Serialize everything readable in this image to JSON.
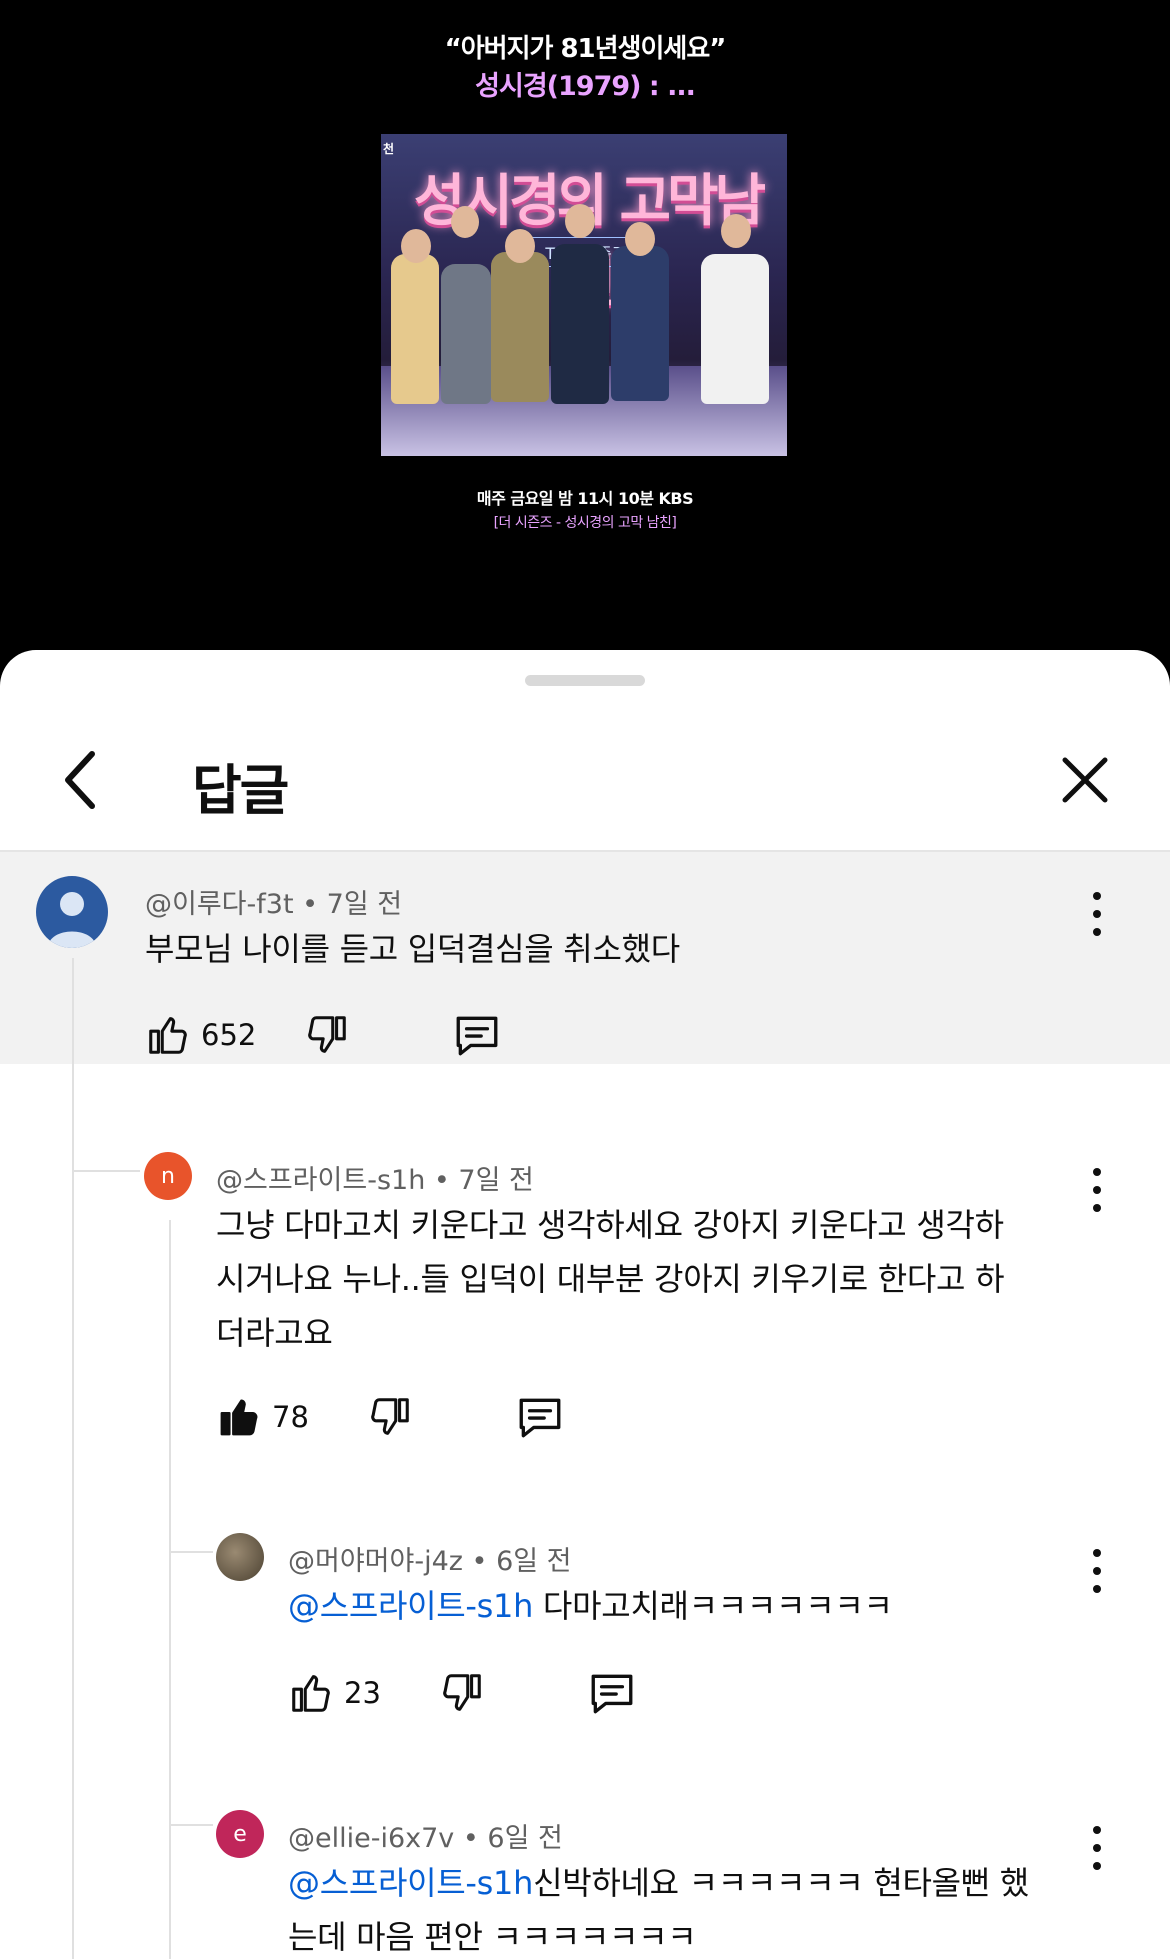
{
  "video": {
    "caption_quote": "“아버지가 81년생이세요”",
    "caption_name": "성시경(1979) : ...",
    "thumb_tag": "천",
    "thumb_title": "성시경의 고막남친",
    "thumb_subtitle": "THE 시즌즈",
    "broadcast": "매주 금요일 밤 11시 10분 KBS",
    "program": "[더 시즌즈 - 성시경의 고막 남친]"
  },
  "sheet": {
    "title": "답글"
  },
  "comments": [
    {
      "avatar_letter": "",
      "avatar_color": "#2c5aa0",
      "author": "@이루다-f3t",
      "time": "7일 전",
      "text": "부모님 나이를 듣고 입덕결심을 취소했다",
      "likes": "652"
    },
    {
      "avatar_letter": "n",
      "avatar_color": "#e8542b",
      "author": "@스프라이트-s1h",
      "time": "7일 전",
      "line1": "그냥 다마고치 키운다고 생각하세요 강아지 키운다고 생각하",
      "line2": "시거나요 누나..들 입덕이 대부분 강아지 키우기로 한다고 하",
      "line3": "더라고요",
      "likes": "78"
    },
    {
      "avatar_letter": "",
      "avatar_color": "#6b6050",
      "author": "@머야머야-j4z",
      "time": "6일 전",
      "mention": "@스프라이트-s1h",
      "text": " 다마고치래ㅋㅋㅋㅋㅋㅋㅋ",
      "likes": "23"
    },
    {
      "avatar_letter": "e",
      "avatar_color": "#c0265a",
      "author": "@ellie-i6x7v",
      "time": "6일 전",
      "mention": "@스프라이트-s1h",
      "line1": "신박하네요 ㅋㅋㅋㅋㅋㅋ 현타올뻔 했",
      "line2": "는데 마음 편안 ㅋㅋㅋㅋㅋㅋㅋ"
    }
  ],
  "icons": {
    "back": "chevron-left-icon",
    "close": "close-icon",
    "like": "thumbs-up-icon",
    "dislike": "thumbs-down-icon",
    "reply": "comment-icon",
    "more": "more-vert-icon"
  },
  "colors": {
    "mention": "#065fd4",
    "caption_accent": "#e9a3ff",
    "highlight_bg": "#f2f2f2"
  }
}
